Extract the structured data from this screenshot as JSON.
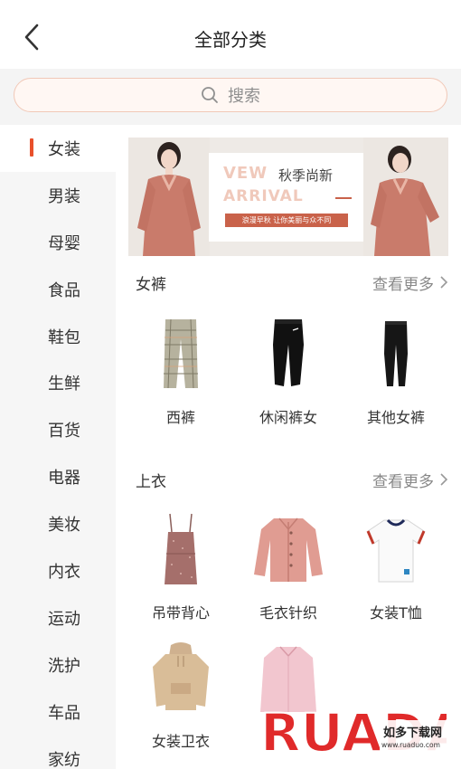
{
  "header": {
    "title": "全部分类",
    "back_icon": "chevron-left-icon"
  },
  "search": {
    "placeholder": "搜索",
    "icon": "search-icon"
  },
  "sidebar": {
    "active_color": "#e8502b",
    "items": [
      {
        "label": "女装",
        "active": true
      },
      {
        "label": "男装"
      },
      {
        "label": "母婴"
      },
      {
        "label": "食品"
      },
      {
        "label": "鞋包"
      },
      {
        "label": "生鲜"
      },
      {
        "label": "百货"
      },
      {
        "label": "电器"
      },
      {
        "label": "美妆"
      },
      {
        "label": "内衣"
      },
      {
        "label": "运动"
      },
      {
        "label": "洗护"
      },
      {
        "label": "车品"
      },
      {
        "label": "家纺"
      }
    ]
  },
  "banner": {
    "line1": "VEW",
    "line1b": "秋季尚新",
    "line2": "ARRIVAL",
    "tagline": "浪漫早秋 让你美丽与众不同"
  },
  "sections": [
    {
      "title": "女裤",
      "more": "查看更多",
      "items": [
        {
          "label": "西裤",
          "icon": "plaid-trousers-icon"
        },
        {
          "label": "休闲裤女",
          "icon": "black-joggers-icon"
        },
        {
          "label": "其他女裤",
          "icon": "black-leggings-icon"
        }
      ]
    },
    {
      "title": "上衣",
      "more": "查看更多",
      "items": [
        {
          "label": "吊带背心",
          "icon": "camisole-icon"
        },
        {
          "label": "毛衣针织",
          "icon": "cardigan-icon"
        },
        {
          "label": "女装T恤",
          "icon": "tshirt-icon"
        },
        {
          "label": "女装卫衣",
          "icon": "hoodie-icon"
        },
        {
          "label": "",
          "icon": "pink-shirt-icon"
        }
      ]
    }
  ],
  "watermark": {
    "brand": "RUADAOO",
    "site_cn": "如多下载网",
    "site_url": "www.ruaduo.com"
  }
}
